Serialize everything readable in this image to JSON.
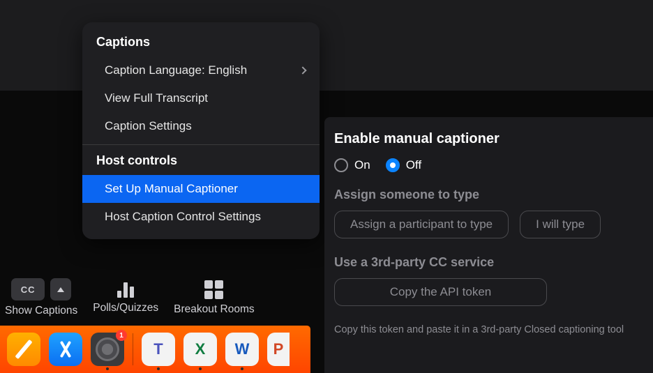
{
  "captions_menu": {
    "header": "Captions",
    "language_item": "Caption Language: English",
    "transcript_item": "View Full Transcript",
    "settings_item": "Caption Settings",
    "host_header": "Host controls",
    "manual_item": "Set Up Manual Captioner",
    "host_settings_item": "Host Caption Control Settings"
  },
  "panel": {
    "title": "Enable manual captioner",
    "radio_on": "On",
    "radio_off": "Off",
    "assign_label": "Assign someone to type",
    "assign_btn": "Assign a participant to type",
    "self_btn": "I will type",
    "thirdparty_label": "Use a 3rd-party CC service",
    "token_btn": "Copy the API token",
    "token_help": "Copy this token and paste it in a 3rd-party Closed captioning tool"
  },
  "toolbar": {
    "cc": "CC",
    "captions_label": "Show Captions",
    "polls_label": "Polls/Quizzes",
    "breakout_label": "Breakout Rooms"
  },
  "dock": {
    "badge": "1",
    "teams": "T",
    "excel": "X",
    "word": "W",
    "ppt": "P"
  }
}
